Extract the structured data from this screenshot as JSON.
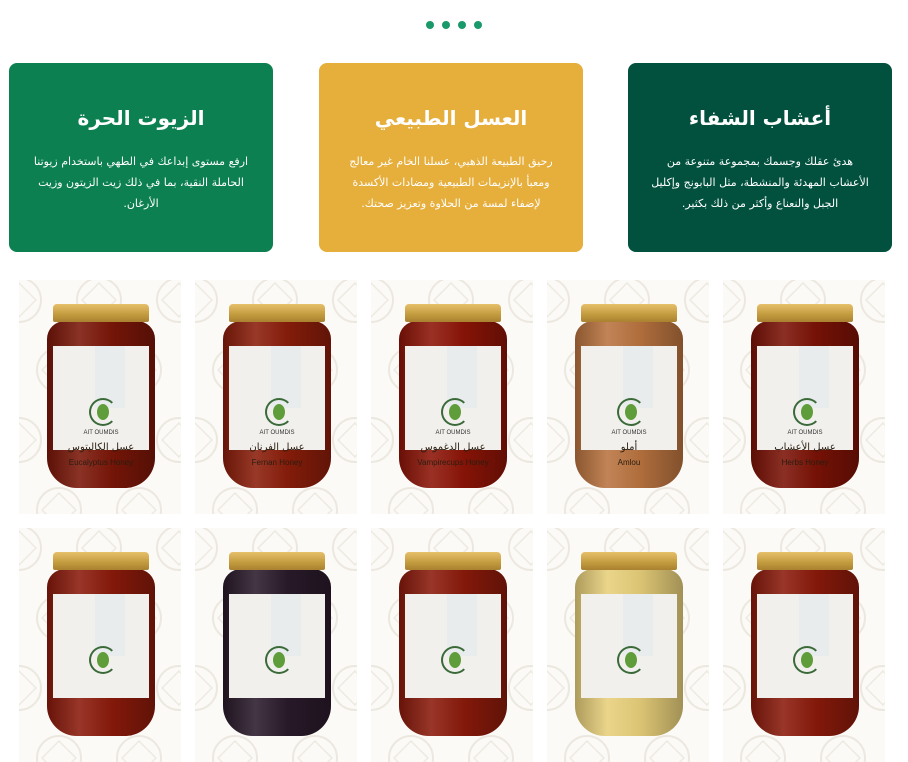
{
  "carousel": {
    "dots": 4
  },
  "cards": [
    {
      "id": "oils",
      "title": "الزيوت الحرة",
      "text": "ارفع مستوى إبداعك في الطهي باستخدام زيوتنا الحاملة النقية، بما في ذلك زيت الزيتون وزيت الأرغان.",
      "color": "#0c8050"
    },
    {
      "id": "honey",
      "title": "العسل الطبيعي",
      "text": "رحيق الطبيعة الذهبي، عسلنا الخام غير معالج ومعبأ بالإنزيمات الطبيعية ومضادات الأكسدة لإضفاء لمسة من الحلاوة وتعزيز صحتك.",
      "color": "#e6ae3b"
    },
    {
      "id": "herbs",
      "title": "أعشاب الشفاء",
      "text": "هدئ عقلك وجسمك بمجموعة متنوعة من الأعشاب المهدئة والمنشطة، مثل البابونج وإكليل الجبل والنعناع وأكثر من ذلك بكثير.",
      "color": "#02513f"
    }
  ],
  "products": [
    {
      "brand": "AIT OUMDIS",
      "name_ar": "عسل الكاليتوس",
      "name_en": "Eucalyptus Honey",
      "color": "#7a1608"
    },
    {
      "brand": "AIT OUMDIS",
      "name_ar": "عسل الفرنان",
      "name_en": "Fernan Honey",
      "color": "#8a1d0a"
    },
    {
      "brand": "AIT OUMDIS",
      "name_ar": "عسل الدغموس",
      "name_en": "Vampirecups Honey",
      "color": "#8c1407"
    },
    {
      "brand": "AIT OUMDIS",
      "name_ar": "أملو",
      "name_en": "Amlou",
      "color": "#b9733f"
    },
    {
      "brand": "AIT OUMDIS",
      "name_ar": "عسل الأعشاب",
      "name_en": "Herbs Honey",
      "color": "#7b1206"
    },
    {
      "brand": "",
      "name_ar": "",
      "name_en": "",
      "color": "#8a1a0b"
    },
    {
      "brand": "",
      "name_ar": "",
      "name_en": "",
      "color": "#2a1a2a"
    },
    {
      "brand": "",
      "name_ar": "",
      "name_en": "",
      "color": "#8a1a0b"
    },
    {
      "brand": "",
      "name_ar": "",
      "name_en": "",
      "color": "#e7cf7a"
    },
    {
      "brand": "",
      "name_ar": "",
      "name_en": "",
      "color": "#8a1a0b"
    }
  ]
}
